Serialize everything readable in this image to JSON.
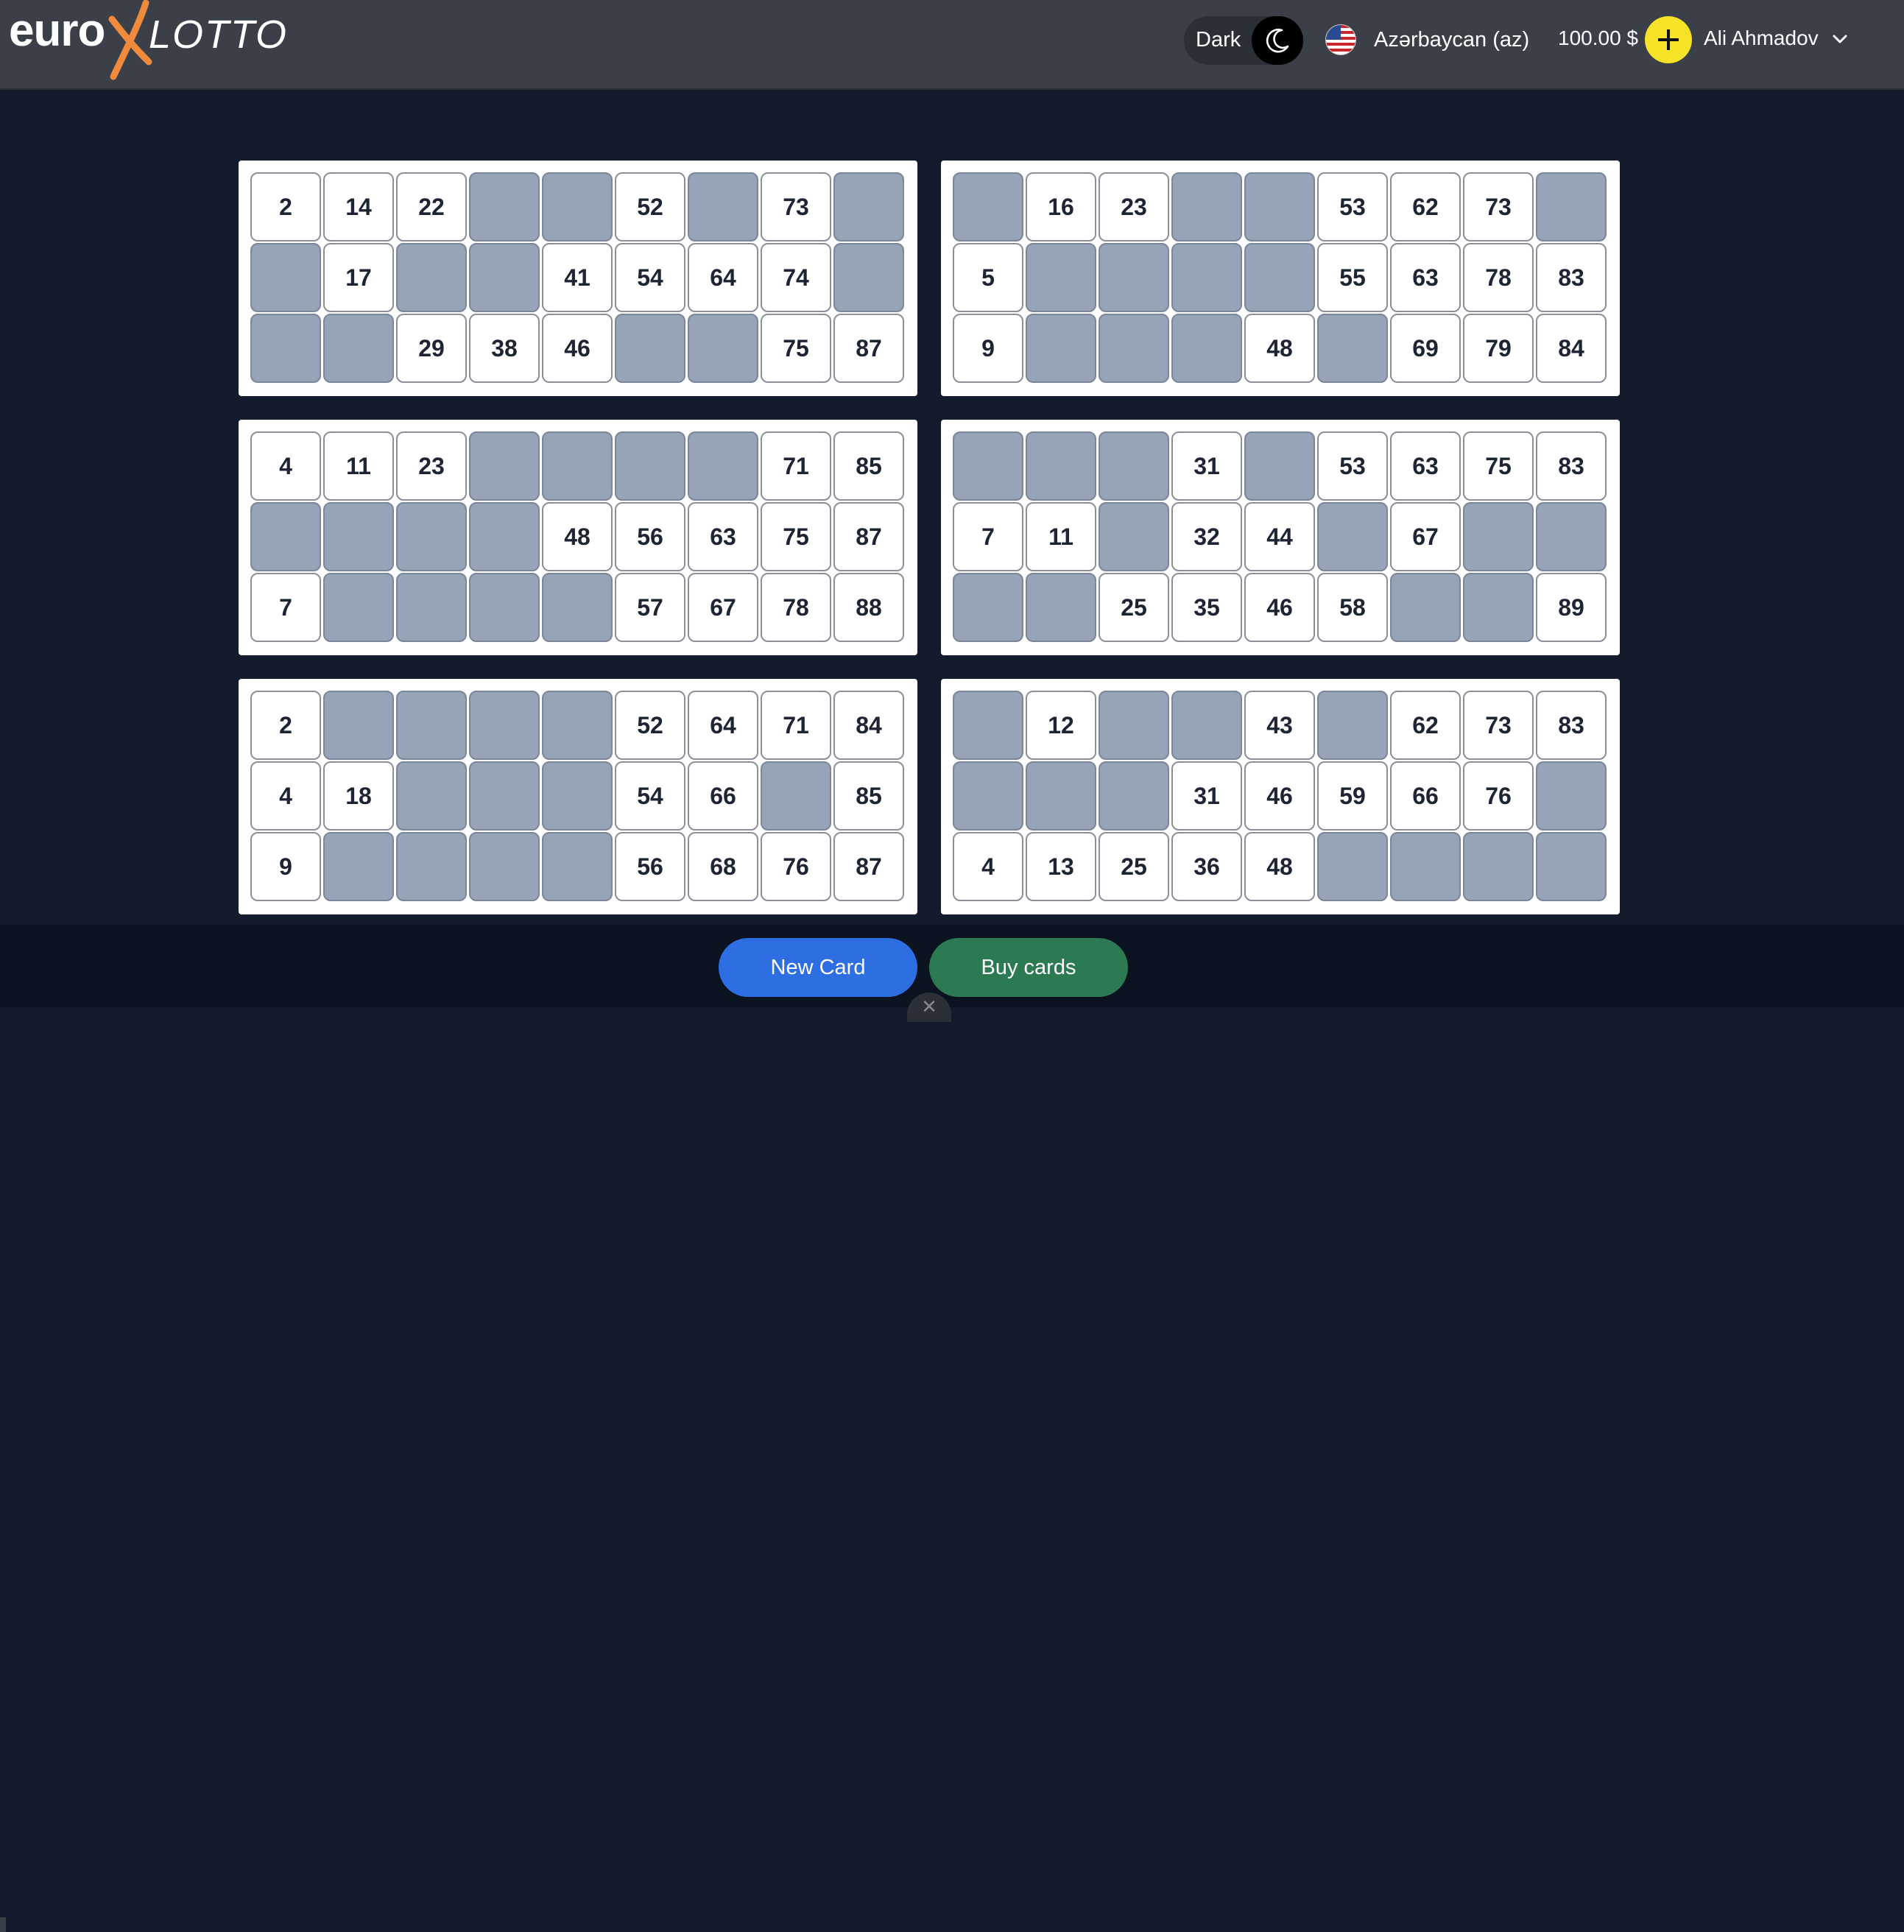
{
  "header": {
    "logo": {
      "part1": "euro",
      "part2": "LOTTO",
      "x_color": "#f08a3c"
    },
    "theme": {
      "label": "Dark",
      "icon": "moon-icon"
    },
    "language": {
      "label": "Azərbaycan (az)",
      "icon": "us-flag-icon"
    },
    "balance": "100.00 $",
    "add_funds_icon": "plus-icon",
    "user": {
      "name": "Ali Ahmadov",
      "icon": "chevron-down-icon"
    }
  },
  "cards": [
    [
      [
        "2",
        "14",
        "22",
        "",
        "",
        "52",
        "",
        "73",
        ""
      ],
      [
        "",
        "17",
        "",
        "",
        "41",
        "54",
        "64",
        "74",
        ""
      ],
      [
        "",
        "",
        "29",
        "38",
        "46",
        "",
        "",
        "75",
        "87"
      ]
    ],
    [
      [
        "",
        "16",
        "23",
        "",
        "",
        "53",
        "62",
        "73",
        ""
      ],
      [
        "5",
        "",
        "",
        "",
        "",
        "55",
        "63",
        "78",
        "83"
      ],
      [
        "9",
        "",
        "",
        "",
        "48",
        "",
        "69",
        "79",
        "84"
      ]
    ],
    [
      [
        "4",
        "11",
        "23",
        "",
        "",
        "",
        "",
        "71",
        "85"
      ],
      [
        "",
        "",
        "",
        "",
        "48",
        "56",
        "63",
        "75",
        "87"
      ],
      [
        "7",
        "",
        "",
        "",
        "",
        "57",
        "67",
        "78",
        "88"
      ]
    ],
    [
      [
        "",
        "",
        "",
        "31",
        "",
        "53",
        "63",
        "75",
        "83"
      ],
      [
        "7",
        "11",
        "",
        "32",
        "44",
        "",
        "67",
        "",
        ""
      ],
      [
        "",
        "",
        "25",
        "35",
        "46",
        "58",
        "",
        "",
        "89"
      ]
    ],
    [
      [
        "2",
        "",
        "",
        "",
        "",
        "52",
        "64",
        "71",
        "84"
      ],
      [
        "4",
        "18",
        "",
        "",
        "",
        "54",
        "66",
        "",
        "85"
      ],
      [
        "9",
        "",
        "",
        "",
        "",
        "56",
        "68",
        "76",
        "87"
      ]
    ],
    [
      [
        "",
        "12",
        "",
        "",
        "43",
        "",
        "62",
        "73",
        "83"
      ],
      [
        "",
        "",
        "",
        "31",
        "46",
        "59",
        "66",
        "76",
        ""
      ],
      [
        "4",
        "13",
        "25",
        "36",
        "48",
        "",
        "",
        "",
        ""
      ]
    ]
  ],
  "footer": {
    "new_card": "New Card",
    "buy_cards": "Buy cards",
    "new_card_color": "#2d6ee3",
    "buy_cards_color": "#2c7a52"
  },
  "colors": {
    "background": "#141b2d",
    "header": "#3a3f48",
    "empty_cell": "#97a4b8",
    "accent_yellow": "#f6e327"
  }
}
